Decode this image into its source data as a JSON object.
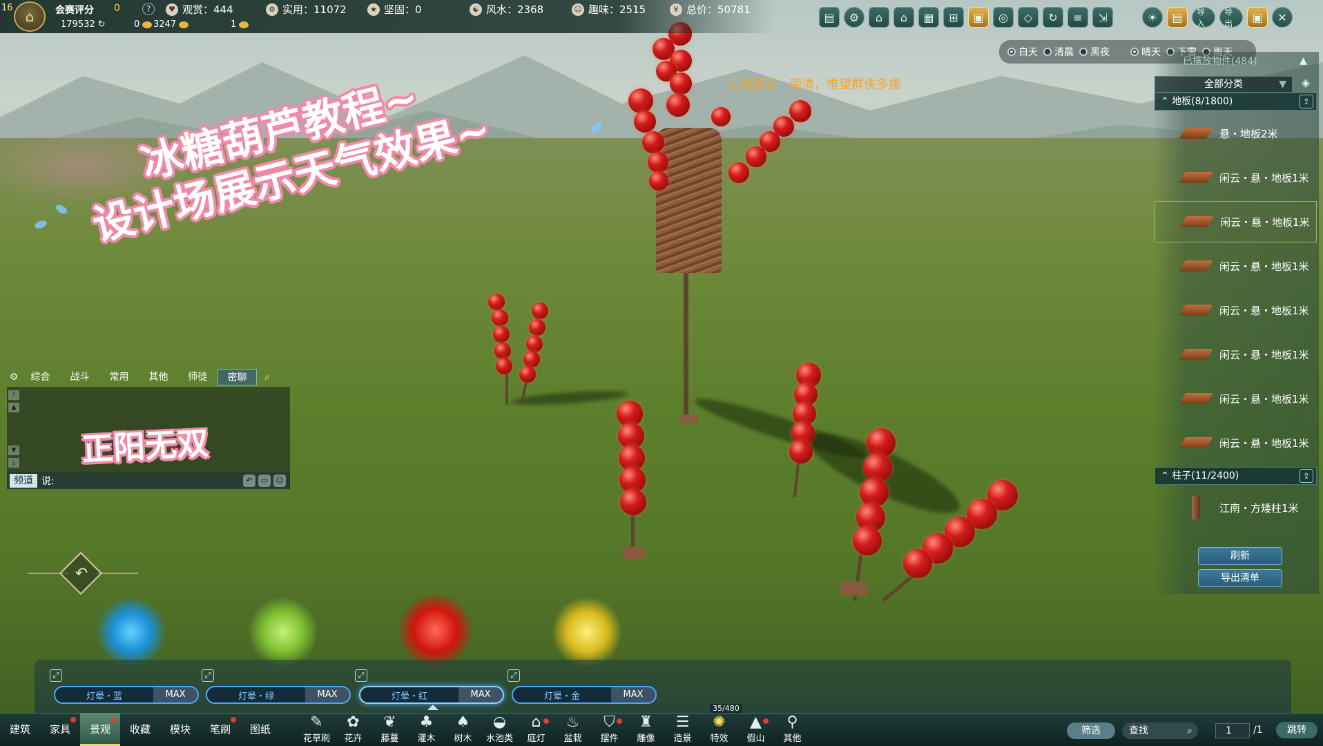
{
  "top_bar": {
    "level": "16",
    "score_label": "会赛评分",
    "score_value": "0",
    "help": "?",
    "currency_1": "179532",
    "currency_2": "0",
    "currency_3": "3247",
    "currency_4": "1",
    "stats": {
      "ornamental": "观赏：444",
      "practical": "实用：11072",
      "sturdy": "坚固：0",
      "fengshui": "风水：2368",
      "fun": "趣味：2515",
      "total": "总价：50781"
    },
    "buttons": {
      "import": "导入",
      "export": "导出"
    }
  },
  "weather": {
    "time_options": [
      "白天",
      "清晨",
      "黑夜"
    ],
    "weather_options": [
      "晴天",
      "下雪",
      "雨天"
    ]
  },
  "announcement": "江湖恩怨一朝清，惟望群侠多援",
  "headline": {
    "line1": "冰糖葫芦教程~",
    "line2": "设计场展示天气效果~"
  },
  "chat": {
    "tabs": [
      "综合",
      "战斗",
      "常用",
      "其他",
      "师徒",
      "密聊"
    ],
    "active_tab": "密聊",
    "sticker_text": "正阳无双",
    "channel_label": "频道",
    "say_label": "说:"
  },
  "right_panel": {
    "placed_title": "已摆放物件(484)",
    "category_select": "全部分类",
    "groups": [
      {
        "header": "地板(8/1800)",
        "items": [
          "悬・地板2米",
          "闲云・悬・地板1米",
          "闲云・悬・地板1米",
          "闲云・悬・地板1米",
          "闲云・悬・地板1米",
          "闲云・悬・地板1米",
          "闲云・悬・地板1米",
          "闲云・悬・地板1米"
        ]
      },
      {
        "header": "柱子(11/2400)",
        "items": [
          "江南・方矮柱1米"
        ]
      }
    ],
    "refresh_label": "刷新",
    "export_list_label": "导出清单"
  },
  "light_slots": [
    {
      "name": "灯晕・蓝",
      "max": "MAX",
      "color": "#1b8fd6"
    },
    {
      "name": "灯晕・绿",
      "max": "MAX",
      "color": "#7fc233"
    },
    {
      "name": "灯晕・红",
      "max": "MAX",
      "color": "#d2140c"
    },
    {
      "name": "灯晕・金",
      "max": "MAX",
      "color": "#d8b81e"
    }
  ],
  "bottom_bar": {
    "main_tabs": [
      "建筑",
      "家具",
      "景观",
      "收藏",
      "模块",
      "笔刷",
      "图纸"
    ],
    "active_main_tab": "景观",
    "sub_categories": [
      "花草刷",
      "花卉",
      "藤蔓",
      "灌木",
      "树木",
      "水池类",
      "庭灯",
      "盆栽",
      "摆件",
      "雕像",
      "造景",
      "特效",
      "假山",
      "其他"
    ],
    "capacity": "35/480",
    "filter_label": "筛选",
    "search_placeholder": "查找",
    "page_current": "1",
    "page_total": "/1",
    "jump_label": "跳转"
  },
  "colors": {
    "accent_gold": "#f0d46a",
    "announce_orange": "#f4a62c",
    "sticker_pink": "#f08aa8",
    "slot_blue": "#4aa7ff"
  }
}
